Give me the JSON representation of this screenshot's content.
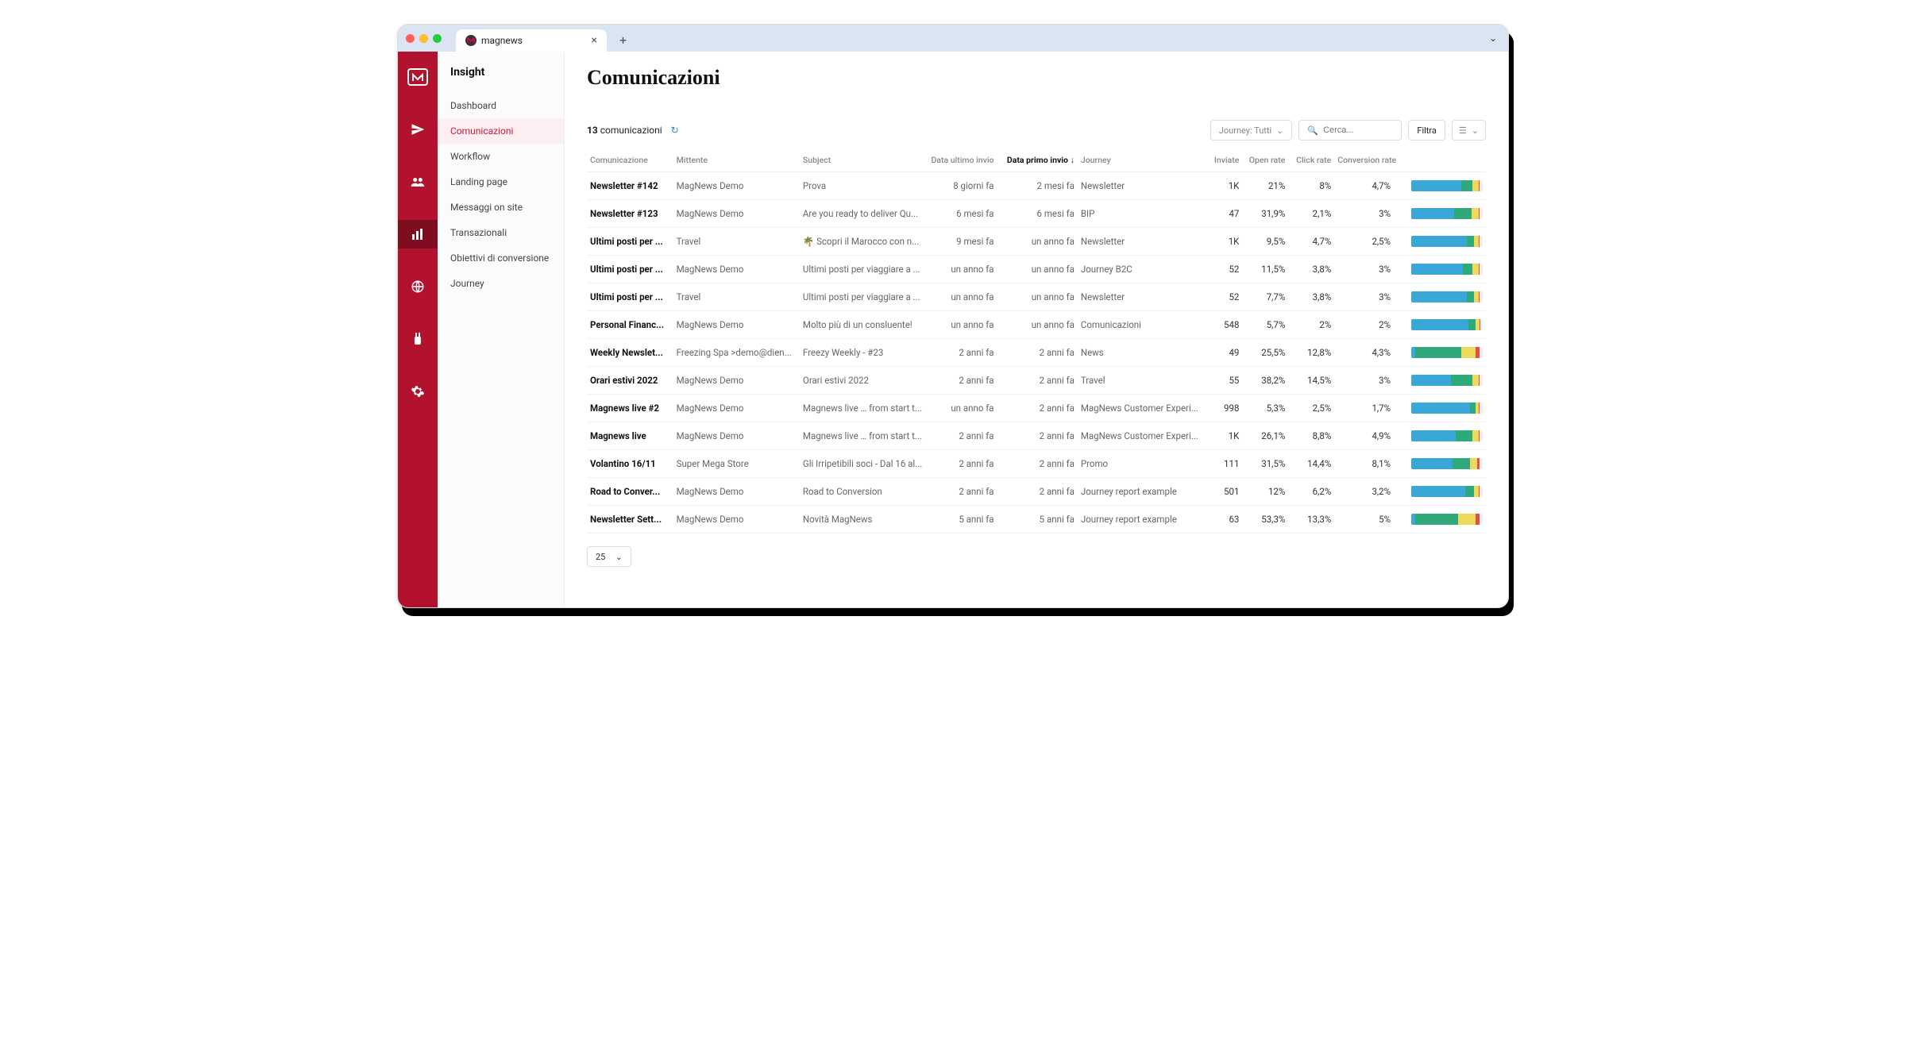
{
  "browser": {
    "tab_title": "magnews"
  },
  "sidebar": {
    "title": "Insight",
    "items": [
      {
        "label": "Dashboard"
      },
      {
        "label": "Comunicazioni"
      },
      {
        "label": "Workflow"
      },
      {
        "label": "Landing page"
      },
      {
        "label": "Messaggi on site"
      },
      {
        "label": "Transazionali"
      },
      {
        "label": "Obiettivi di conversione"
      },
      {
        "label": "Journey"
      }
    ]
  },
  "page": {
    "title": "Comunicazioni",
    "count_number": "13",
    "count_label": "comunicazioni",
    "journey_filter": "Journey: Tutti",
    "search_placeholder": "Cerca...",
    "filter_label": "Filtra",
    "page_size": "25"
  },
  "columns": {
    "c0": "Comunicazione",
    "c1": "Mittente",
    "c2": "Subject",
    "c3": "Data ultimo invio",
    "c4": "Data primo invio",
    "c5": "Journey",
    "c6": "Inviate",
    "c7": "Open rate",
    "c8": "Click rate",
    "c9": "Conversion rate"
  },
  "rows": [
    {
      "name": "Newsletter #142",
      "sender": "MagNews Demo <demo@di...",
      "subject": "Prova",
      "last": "8 giorni fa",
      "first": "2 mesi fa",
      "journey": "Newsletter",
      "sent": "1K",
      "open": "21%",
      "click": "8%",
      "conv": "4,7%",
      "bar": [
        70,
        16,
        8,
        2
      ]
    },
    {
      "name": "Newsletter #123",
      "sender": "MagNews Demo <demo@di...",
      "subject": "Are you ready to deliver Qu...",
      "last": "6 mesi fa",
      "first": "6 mesi fa",
      "journey": "BIP",
      "sent": "47",
      "open": "31,9%",
      "click": "2,1%",
      "conv": "3%",
      "bar": [
        60,
        24,
        10,
        2
      ]
    },
    {
      "name": "Ultimi posti per ...",
      "sender": "Travel <demo@diennea.co...",
      "subject": "🌴 Scopri il Marocco con n...",
      "last": "9 mesi fa",
      "first": "un anno fa",
      "journey": "Newsletter",
      "sent": "1K",
      "open": "9,5%",
      "click": "4,7%",
      "conv": "2,5%",
      "bar": [
        78,
        10,
        6,
        2
      ]
    },
    {
      "name": "Ultimi posti per ...",
      "sender": "MagNews Demo <demo@di...",
      "subject": "Ultimi posti per viaggiare a ...",
      "last": "un anno fa",
      "first": "un anno fa",
      "journey": "Journey B2C",
      "sent": "52",
      "open": "11,5%",
      "click": "3,8%",
      "conv": "3%",
      "bar": [
        72,
        14,
        8,
        2
      ]
    },
    {
      "name": "Ultimi posti per ...",
      "sender": "Travel <demo@diennea.co...",
      "subject": "Ultimi posti per viaggiare a ...",
      "last": "un anno fa",
      "first": "un anno fa",
      "journey": "Newsletter",
      "sent": "52",
      "open": "7,7%",
      "click": "3,8%",
      "conv": "3%",
      "bar": [
        78,
        10,
        6,
        2
      ]
    },
    {
      "name": "Personal Financ...",
      "sender": "MagNews Demo <demo@di...",
      "subject": "Molto più di un consluente!",
      "last": "un anno fa",
      "first": "un anno fa",
      "journey": "Comunicazioni",
      "sent": "548",
      "open": "5,7%",
      "click": "2%",
      "conv": "2%",
      "bar": [
        80,
        10,
        5,
        1
      ]
    },
    {
      "name": "Weekly Newslet...",
      "sender": "Freezing Spa >demo@dien...",
      "subject": "Freezy Weekly - #23",
      "last": "2 anni fa",
      "first": "2 anni fa",
      "journey": "News",
      "sent": "49",
      "open": "25,5%",
      "click": "12,8%",
      "conv": "4,3%",
      "bar": [
        6,
        64,
        20,
        6
      ]
    },
    {
      "name": "Orari estivi 2022",
      "sender": "MagNews Demo <demo@di...",
      "subject": "Orari estivi 2022",
      "last": "2 anni fa",
      "first": "2 anni fa",
      "journey": "Travel",
      "sent": "55",
      "open": "38,2%",
      "click": "14,5%",
      "conv": "3%",
      "bar": [
        56,
        30,
        8,
        2
      ]
    },
    {
      "name": "Magnews live #2",
      "sender": "MagNews Demo <demo@di...",
      "subject": "Magnews live … from start t...",
      "last": "un anno fa",
      "first": "2 anni fa",
      "journey": "MagNews Customer Experi...",
      "sent": "998",
      "open": "5,3%",
      "click": "2,5%",
      "conv": "1,7%",
      "bar": [
        82,
        8,
        4,
        2
      ]
    },
    {
      "name": "Magnews live",
      "sender": "MagNews Demo <demo@di...",
      "subject": "Magnews live … from start t...",
      "last": "2 anni fa",
      "first": "2 anni fa",
      "journey": "MagNews Customer Experi...",
      "sent": "1K",
      "open": "26,1%",
      "click": "8,8%",
      "conv": "4,9%",
      "bar": [
        62,
        24,
        8,
        2
      ]
    },
    {
      "name": "Volantino 16/11",
      "sender": "Super Mega Store <noreply...",
      "subject": "Gli Irripetibili soci - Dal 16 al...",
      "last": "2 anni fa",
      "first": "2 anni fa",
      "journey": "Promo",
      "sent": "111",
      "open": "31,5%",
      "click": "14,4%",
      "conv": "8,1%",
      "bar": [
        58,
        24,
        10,
        4
      ]
    },
    {
      "name": "Road to Conver...",
      "sender": "MagNews Demo <demo@di...",
      "subject": "Road to Conversion",
      "last": "2 anni fa",
      "first": "2 anni fa",
      "journey": "Journey report example",
      "sent": "501",
      "open": "12%",
      "click": "6,2%",
      "conv": "3,2%",
      "bar": [
        76,
        12,
        6,
        2
      ]
    },
    {
      "name": "Newsletter Sett...",
      "sender": "MagNews Demo <demo@di...",
      "subject": "Novità MagNews",
      "last": "5 anni fa",
      "first": "5 anni fa",
      "journey": "Journey report example",
      "sent": "63",
      "open": "53,3%",
      "click": "13,3%",
      "conv": "5%",
      "bar": [
        6,
        60,
        24,
        6
      ]
    }
  ]
}
